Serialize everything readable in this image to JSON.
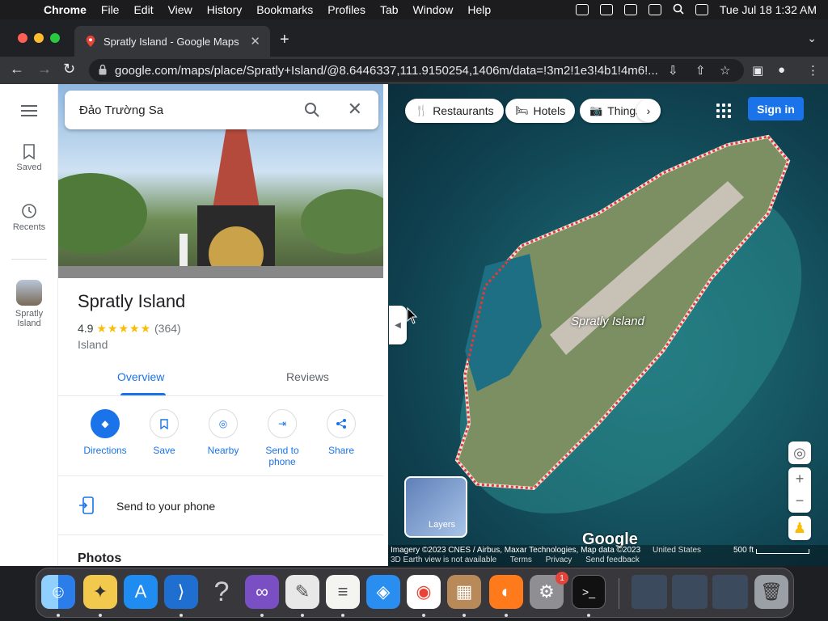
{
  "menubar": {
    "app": "Chrome",
    "items": [
      "File",
      "Edit",
      "View",
      "History",
      "Bookmarks",
      "Profiles",
      "Tab",
      "Window",
      "Help"
    ],
    "datetime": "Tue Jul 18  1:32 AM"
  },
  "browser": {
    "tab_title": "Spratly Island - Google Maps",
    "url": "google.com/maps/place/Spratly+Island/@8.6446337,111.9150254,1406m/data=!3m2!1e3!4b1!4m6!..."
  },
  "rail": {
    "saved_label": "Saved",
    "recents_label": "Recents",
    "place_label": "Spratly Island"
  },
  "search": {
    "value": "Đảo Trường Sa"
  },
  "place": {
    "title": "Spratly Island",
    "rating": "4.9",
    "stars": "★★★★★",
    "reviews": "(364)",
    "type": "Island"
  },
  "tabs": {
    "overview": "Overview",
    "reviews": "Reviews"
  },
  "actions": {
    "directions": "Directions",
    "save": "Save",
    "nearby": "Nearby",
    "send_to_phone": "Send to phone",
    "share": "Share"
  },
  "send_row": {
    "label": "Send to your phone"
  },
  "photos": {
    "heading": "Photos"
  },
  "map": {
    "chips": [
      "Restaurants",
      "Hotels",
      "Things"
    ],
    "sign_in": "Sign in",
    "label": "Spratly Island",
    "layers_label": "Layers",
    "google_logo": "Google",
    "attribution": "Imagery ©2023 CNES / Airbus, Maxar Technologies, Map data ©2023",
    "footer_links": [
      "3D Earth view is not available",
      "Terms",
      "Privacy",
      "Send feedback"
    ],
    "region": "United States",
    "scale": "500 ft"
  },
  "dock": {
    "settings_badge": "1"
  },
  "colors": {
    "accent": "#1a73e8",
    "star": "#fbbc04"
  }
}
